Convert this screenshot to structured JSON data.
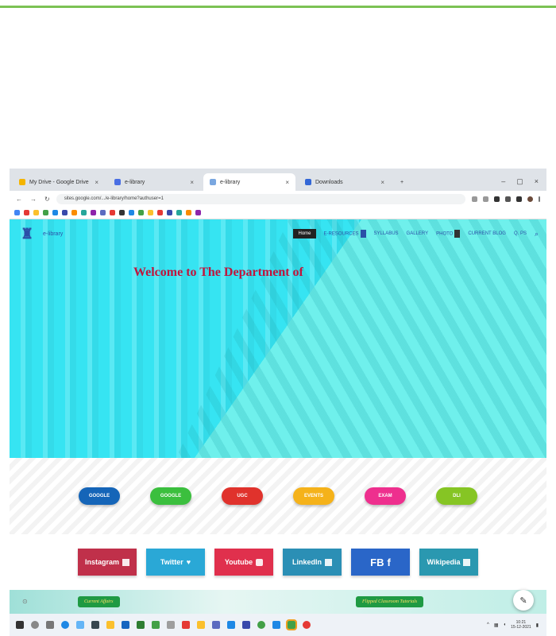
{
  "browser": {
    "tabs": [
      {
        "label": "My Drive - Google Drive",
        "color": "#f4b400"
      },
      {
        "label": "e-library",
        "color": "#4a6fe3"
      },
      {
        "label": "e-library",
        "color": "#7aa7e0"
      },
      {
        "label": "Downloads",
        "color": "#3367d6"
      }
    ],
    "new_tab": "+",
    "url": "sites.google.com/.../e-library/home?authuser=1"
  },
  "site": {
    "logo_name": "e-library",
    "menu": {
      "home": "Home",
      "items": [
        "E-RESOURCES",
        "SYLLABUS",
        "GALLERY",
        "PHOTO",
        "CURRENT BLOG",
        "Q. PS"
      ]
    },
    "welcome": "Welcome to The Department of",
    "pills": [
      {
        "label": "GOOGLE",
        "color": "#1565b8"
      },
      {
        "label": "GOOGLE",
        "color": "#3bbf3e"
      },
      {
        "label": "UGC",
        "color": "#e0322c"
      },
      {
        "label": "EVENTS",
        "color": "#f5b21a"
      },
      {
        "label": "EXAM",
        "color": "#ee2f8e"
      },
      {
        "label": "DLI",
        "color": "#86c524"
      }
    ],
    "social": [
      {
        "label": "Instagram",
        "color": "#c0304a"
      },
      {
        "label": "Twitter",
        "color": "#2aa8d6"
      },
      {
        "label": "Youtube",
        "color": "#e0304d"
      },
      {
        "label": "LinkedIn",
        "color": "#2b8fb5"
      },
      {
        "label": "FB",
        "color": "#2a66c8"
      },
      {
        "label": "Wikipedia",
        "color": "#2a98b0"
      }
    ],
    "current_affairs": "Current Affairs",
    "flipped_classroom": "Flipped Classroom Tutorials"
  },
  "taskbar": {
    "time": "10:21",
    "date": "15-12-2021"
  }
}
